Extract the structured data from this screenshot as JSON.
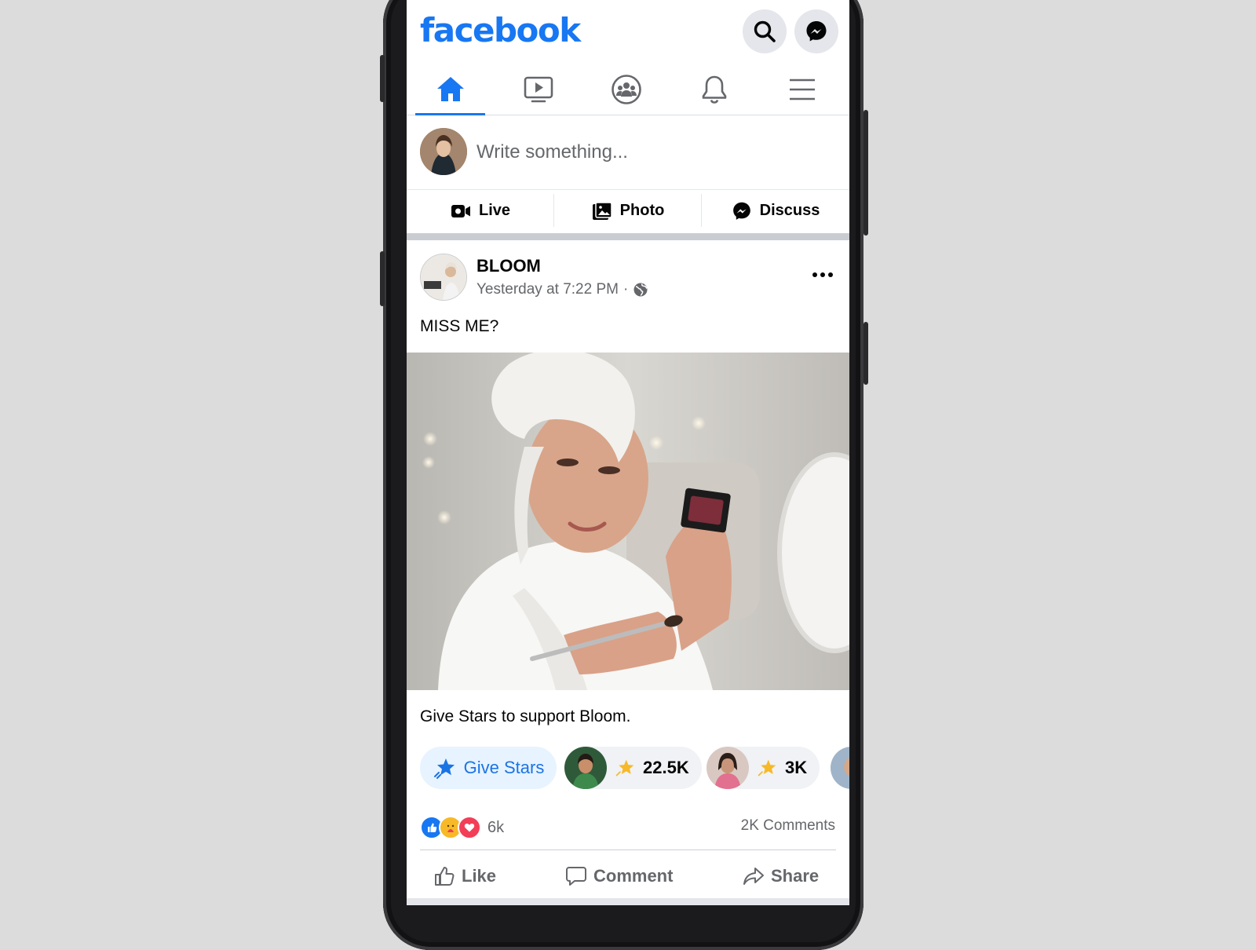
{
  "app": {
    "logo": "facebook"
  },
  "header": {
    "search_icon": "search-icon",
    "messenger_icon": "messenger-icon"
  },
  "nav": {
    "items": [
      {
        "id": "home",
        "icon": "home-icon",
        "active": true
      },
      {
        "id": "watch",
        "icon": "video-icon",
        "active": false
      },
      {
        "id": "groups",
        "icon": "groups-icon",
        "active": false
      },
      {
        "id": "notifications",
        "icon": "bell-icon",
        "active": false
      },
      {
        "id": "menu",
        "icon": "menu-icon",
        "active": false
      }
    ]
  },
  "composer": {
    "placeholder": "Write something...",
    "actions": [
      {
        "label": "Live",
        "icon": "live-video-icon"
      },
      {
        "label": "Photo",
        "icon": "photo-icon"
      },
      {
        "label": "Discuss",
        "icon": "messenger-icon"
      }
    ]
  },
  "post": {
    "author": "BLOOM",
    "timestamp": "Yesterday at 7:22 PM",
    "separator": "·",
    "privacy_icon": "globe-icon",
    "text": "MISS ME?",
    "stars_prompt": "Give Stars to support Bloom.",
    "give_stars_label": "Give Stars",
    "star_supporters": [
      {
        "count": "22.5K"
      },
      {
        "count": "3K"
      }
    ],
    "reaction_count": "6k",
    "comments_count": "2K Comments",
    "actions": {
      "like": "Like",
      "comment": "Comment",
      "share": "Share"
    }
  },
  "colors": {
    "brand": "#1877f2",
    "secondary_text": "#65676b",
    "star": "#f7b928",
    "love": "#f33e58"
  }
}
